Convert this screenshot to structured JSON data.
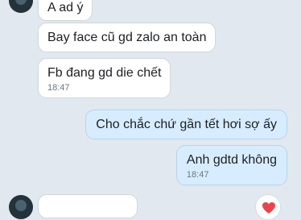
{
  "messages": [
    {
      "id": "m1",
      "direction": "incoming",
      "text": "A ad ý"
    },
    {
      "id": "m2",
      "direction": "incoming",
      "text": "Bay face cũ gd zalo an toàn"
    },
    {
      "id": "m3",
      "direction": "incoming",
      "text": "Fb đang gd die chết",
      "time": "18:47"
    },
    {
      "id": "m4",
      "direction": "outgoing",
      "text": "Cho chắc chứ gần tết hơi sợ ấy"
    },
    {
      "id": "m5",
      "direction": "outgoing",
      "text": "Anh gdtd không",
      "time": "18:47"
    }
  ],
  "icons": {
    "avatar": "contact-avatar",
    "reaction": "heart-icon"
  },
  "colors": {
    "background": "#e2e8ef",
    "incoming_bubble": "#ffffff",
    "outgoing_bubble": "#d7edff",
    "heart": "#e8454f"
  }
}
